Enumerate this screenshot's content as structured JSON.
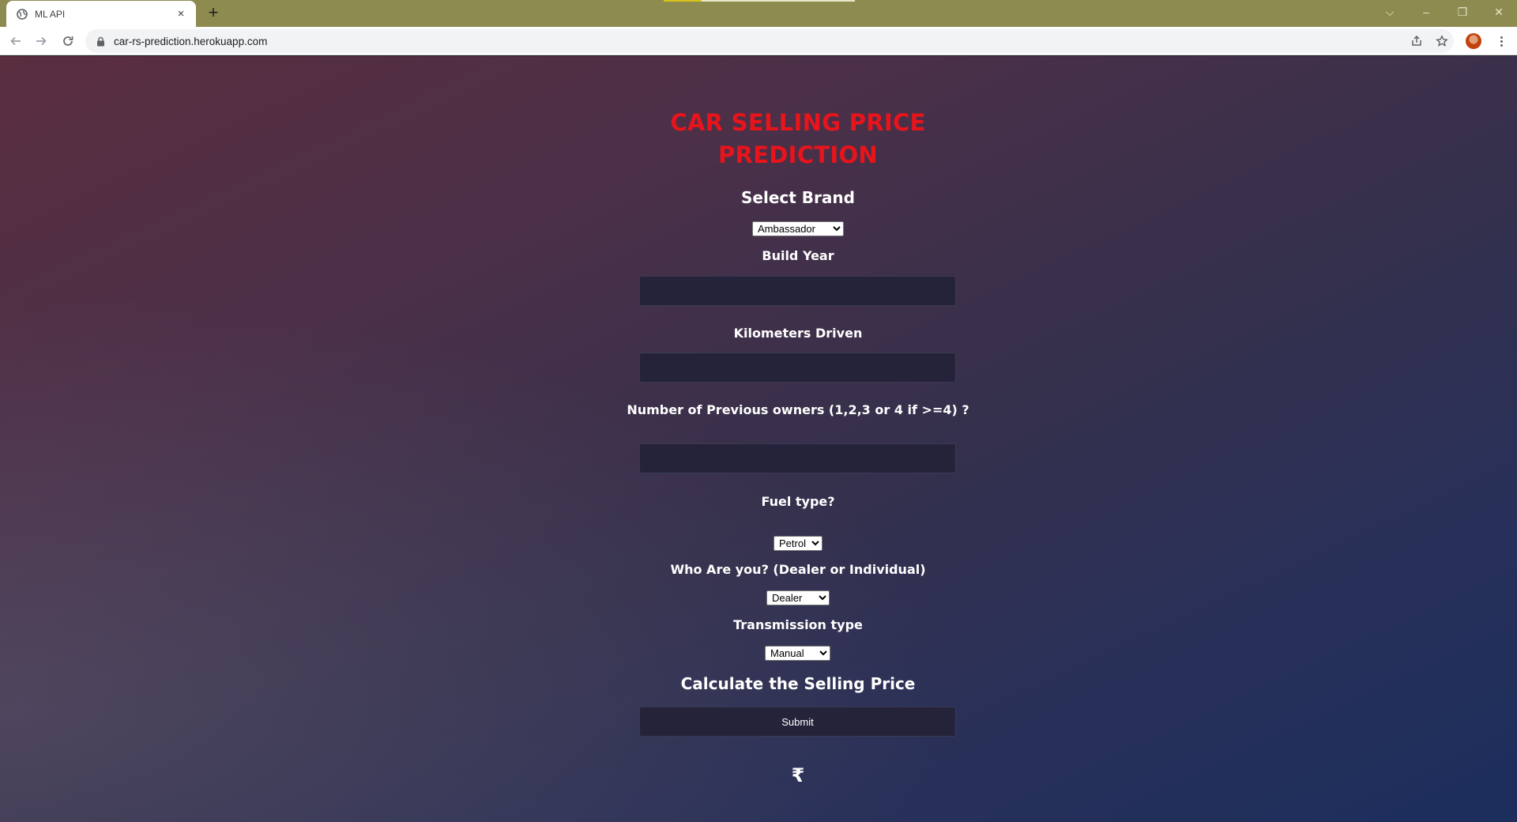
{
  "browser": {
    "tab_title": "ML API",
    "tab_close": "×",
    "new_tab": "+",
    "url": "car-rs-prediction.herokuapp.com",
    "window_controls": {
      "collapse": "⌵",
      "minimize": "–",
      "restore": "❐",
      "close": "✕"
    }
  },
  "page": {
    "title_line1": "CAR SELLING PRICE",
    "title_line2": "PREDICTION",
    "brand": {
      "label": "Select Brand",
      "selected": "Ambassador"
    },
    "year": {
      "label": "Build Year",
      "value": ""
    },
    "kms": {
      "label": "Kilometers Driven",
      "value": ""
    },
    "owners": {
      "label": "Number of Previous owners (1,2,3 or 4 if >=4) ?",
      "value": ""
    },
    "fuel": {
      "label": "Fuel type?",
      "selected": "Petrol"
    },
    "seller": {
      "label": "Who Are you? (Dealer or Individual)",
      "selected": "Dealer"
    },
    "transmission": {
      "label": "Transmission type",
      "selected": "Manual"
    },
    "calc_heading": "Calculate the Selling Price",
    "submit_label": "Submit",
    "result_symbol": "₹"
  },
  "colors": {
    "title": "#e8141c",
    "tabstrip": "#8e8b51",
    "field_bg": "#25233a"
  }
}
